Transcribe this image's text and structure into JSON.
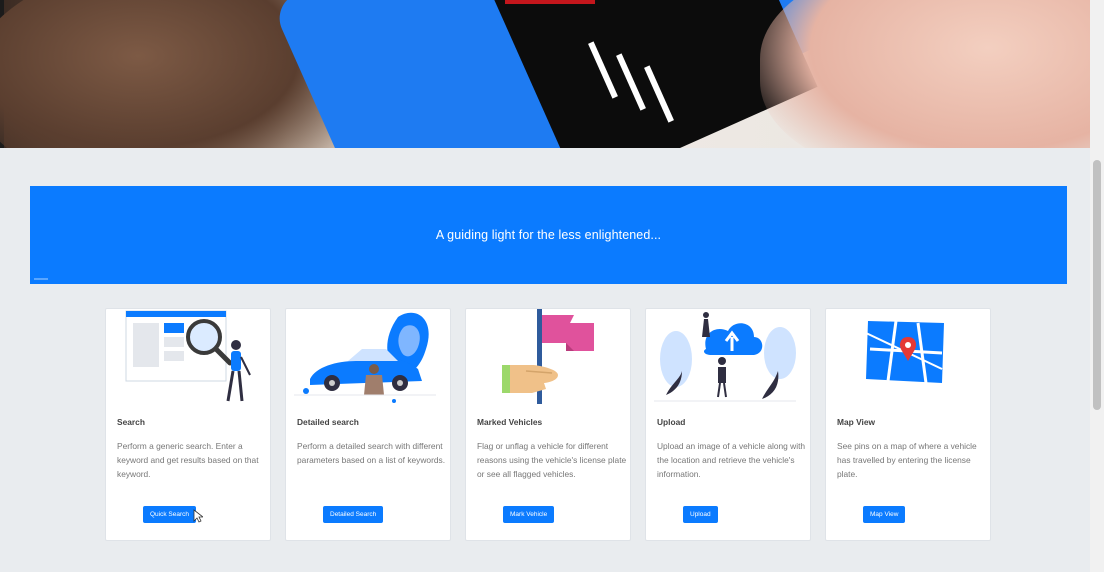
{
  "banner": {
    "tagline": "A guiding light for the less enlightened..."
  },
  "cards": [
    {
      "title": "Search",
      "description": "Perform a generic search. Enter a keyword and get results based on that keyword.",
      "button": "Quick Search",
      "icon": "search-illustration"
    },
    {
      "title": "Detailed search",
      "description": "Perform a detailed search with different parameters based on a list of keywords.",
      "button": "Detailed Search",
      "icon": "car-illustration"
    },
    {
      "title": "Marked Vehicles",
      "description": "Flag or unflag a vehicle for different reasons using the vehicle's license plate or see all flagged vehicles.",
      "button": "Mark Vehicle",
      "icon": "flag-illustration"
    },
    {
      "title": "Upload",
      "description": "Upload an image of a vehicle along with the location and retrieve the vehicle's information.",
      "button": "Upload",
      "icon": "cloud-upload-illustration"
    },
    {
      "title": "Map View",
      "description": "See pins on a map of where a vehicle has travelled by entering the license plate.",
      "button": "Map View",
      "icon": "map-pin-illustration"
    }
  ],
  "colors": {
    "accent": "#0b7bff",
    "background": "#e9ecef",
    "card": "#ffffff"
  }
}
